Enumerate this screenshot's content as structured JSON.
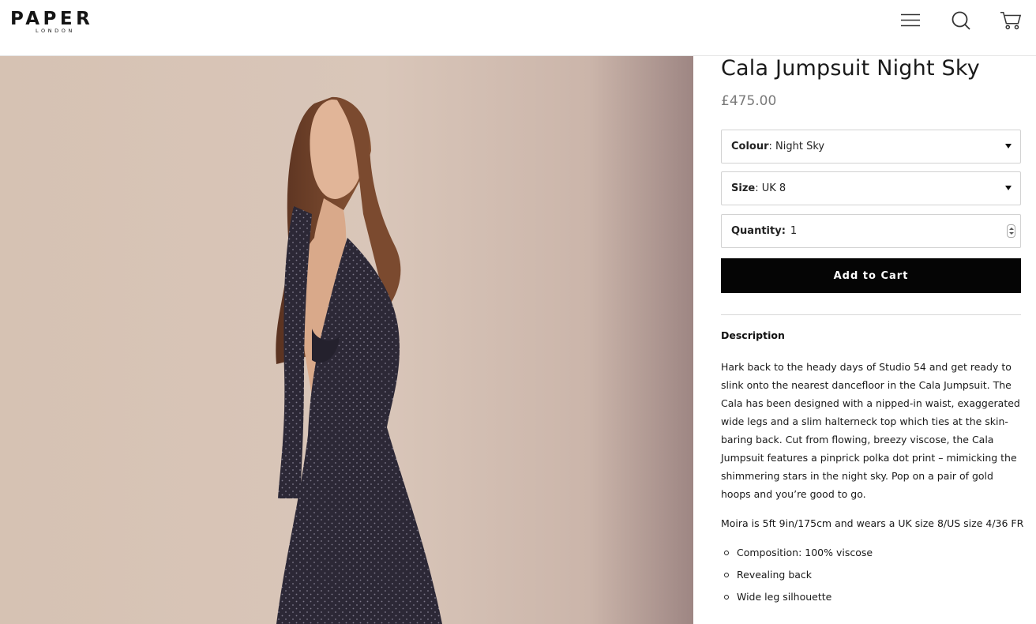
{
  "header": {
    "logo_main": "PAPER",
    "logo_sub": "LONDON",
    "icons": [
      "menu-icon",
      "search-icon",
      "cart-icon"
    ]
  },
  "product": {
    "title": "Cala Jumpsuit Night Sky",
    "price": "£475.00",
    "colour": {
      "label": "Colour",
      "value": "Night Sky"
    },
    "size": {
      "label": "Size",
      "value": "UK 8"
    },
    "quantity": {
      "label": "Quantity:",
      "value": "1"
    },
    "add_to_cart": "Add to Cart"
  },
  "description": {
    "heading": "Description",
    "paragraph1": "Hark back to the heady days of Studio 54 and get ready to slink onto the nearest dancefloor in the Cala Jumpsuit. The Cala has been designed with a nipped-in waist, exaggerated wide legs and a slim halterneck top which ties at the skin-baring back. Cut from flowing, breezy viscose, the Cala Jumpsuit features a pinprick polka dot print – mimicking the shimmering stars in the night sky. Pop on a pair of gold hoops and you’re good to go.",
    "paragraph2": " Moira is 5ft 9in/175cm and wears a UK size 8/US size 4/36 FR",
    "bullets": [
      "Composition: 100% viscose",
      "Revealing back",
      "Wide leg silhouette"
    ]
  },
  "colors": {
    "button_bg": "#050505",
    "price": "#7a7a7a",
    "border": "#d2d2d2"
  }
}
